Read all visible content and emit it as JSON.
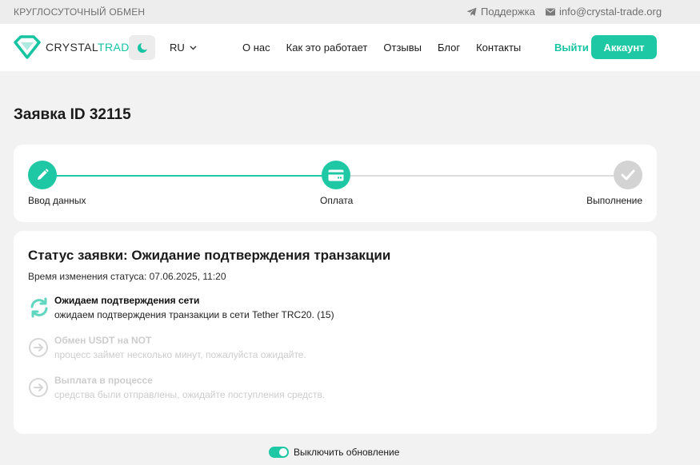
{
  "topbar": {
    "tagline": "КРУГЛОСУТОЧНЫЙ ОБМЕН",
    "support_label": "Поддержка",
    "email": "info@crystal-trade.org"
  },
  "header": {
    "logo_part1": "CRYSTAL",
    "logo_part2": "TRADE",
    "lang": "RU",
    "nav": [
      "О нас",
      "Как это работает",
      "Отзывы",
      "Блог",
      "Контакты"
    ],
    "logout_label": "Выйти",
    "account_label": "Аккаунт"
  },
  "page": {
    "title": "Заявка ID 32115"
  },
  "progress": {
    "steps": [
      {
        "label": "Ввод данных",
        "state": "done"
      },
      {
        "label": "Оплата",
        "state": "current"
      },
      {
        "label": "Выполнение",
        "state": "pending"
      }
    ]
  },
  "status": {
    "title": "Статус заявки: Ожидание подтверждения транзакции",
    "time": "Время изменения статуса: 07.06.2025, 11:20",
    "items": [
      {
        "title": "Ожидаем подтверждения сети",
        "desc": "ожидаем подтверждения транзакции в сети Tether TRC20. (15)",
        "icon": "sync-icon",
        "active": true
      },
      {
        "title": "Обмен USDT на NOT",
        "desc": "процесс займет несколько минут, пожалуйста ожидайте.",
        "icon": "arrow-right-circle-icon",
        "active": false
      },
      {
        "title": "Выплата в процессе",
        "desc": "средства были отправлены, ожидайте поступления средств.",
        "icon": "arrow-right-circle-icon",
        "active": false
      }
    ]
  },
  "footer": {
    "toggle_label": "Выключить обновление",
    "toggle_on": true
  },
  "colors": {
    "accent": "#1ec8a5",
    "pending": "#d3d3d3"
  }
}
